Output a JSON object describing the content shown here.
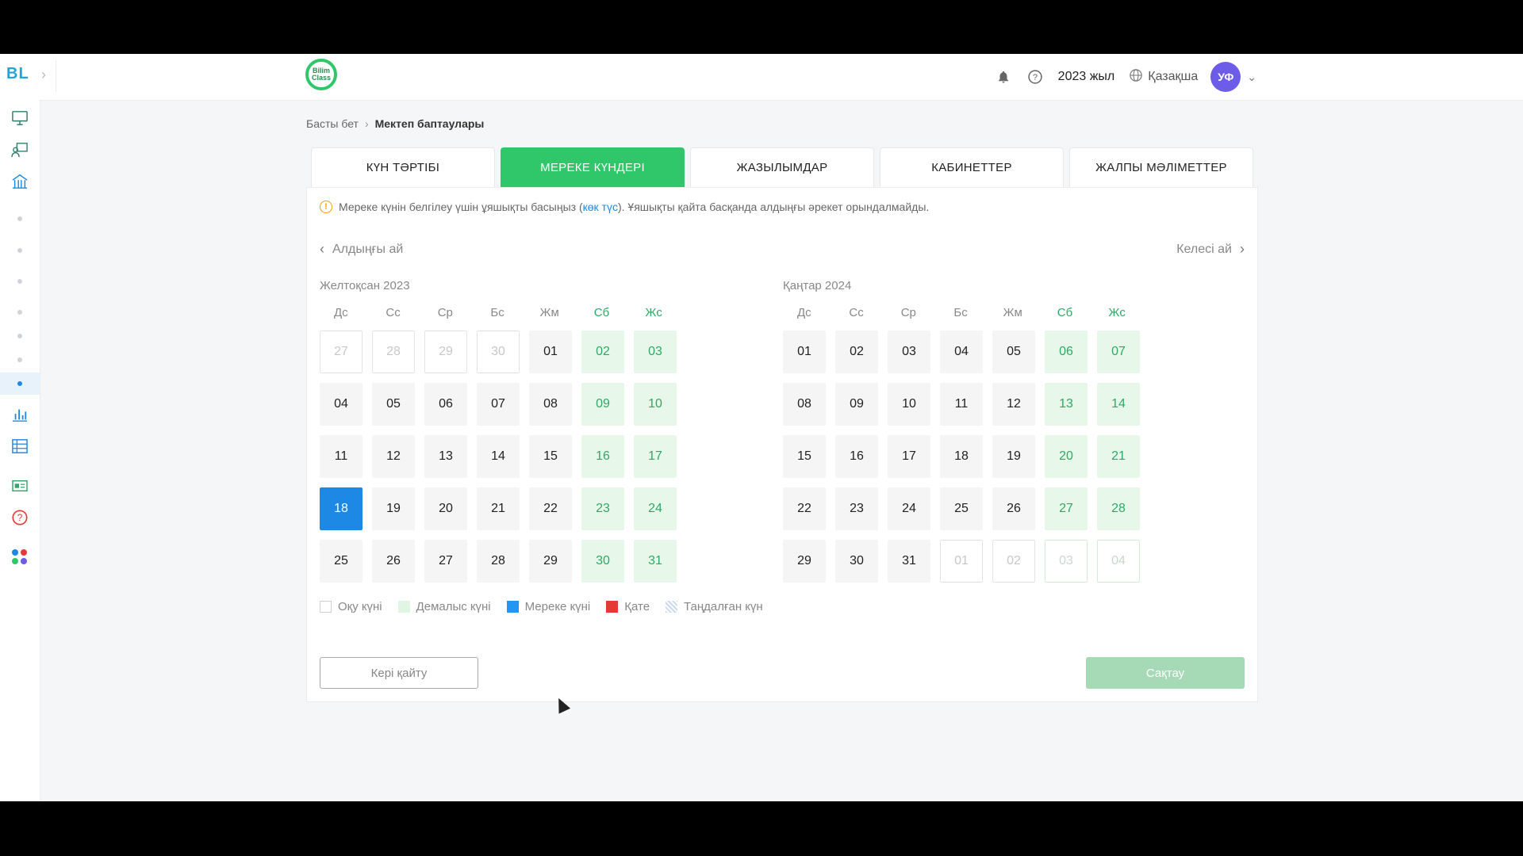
{
  "header": {
    "app_logo": "BL",
    "brand": "Bilim Class",
    "year": "2023 жыл",
    "language": "Қазақша",
    "avatar": "УФ"
  },
  "breadcrumb": {
    "home": "Басты бет",
    "current": "Мектеп баптаулары"
  },
  "tabs": [
    {
      "label": "КҮН ТӘРТІБІ"
    },
    {
      "label": "МЕРЕКЕ КҮНДЕРІ"
    },
    {
      "label": "ЖАЗЫЛЫМДАР"
    },
    {
      "label": "КАБИНЕТТЕР"
    },
    {
      "label": "ЖАЛПЫ МӘЛІМЕТТЕР"
    }
  ],
  "info": {
    "text_before": "Мереке күнін белгілеу үшін ұяшықты басыңыз (",
    "link": "көк түс",
    "text_after": "). Ұяшықты қайта басқанда алдыңғы әрекет орындалмайды."
  },
  "nav": {
    "prev": "Алдыңғы ай",
    "next": "Келесі ай"
  },
  "weekdays": [
    "Дс",
    "Сс",
    "Ср",
    "Бс",
    "Жм",
    "Сб",
    "Жс"
  ],
  "months": [
    {
      "title": "Желтоқсан 2023",
      "days": [
        {
          "d": "27",
          "t": "out"
        },
        {
          "d": "28",
          "t": "out"
        },
        {
          "d": "29",
          "t": "out"
        },
        {
          "d": "30",
          "t": "out"
        },
        {
          "d": "01",
          "t": "study"
        },
        {
          "d": "02",
          "t": "we"
        },
        {
          "d": "03",
          "t": "we"
        },
        {
          "d": "04",
          "t": "study"
        },
        {
          "d": "05",
          "t": "study"
        },
        {
          "d": "06",
          "t": "study"
        },
        {
          "d": "07",
          "t": "study"
        },
        {
          "d": "08",
          "t": "study"
        },
        {
          "d": "09",
          "t": "we"
        },
        {
          "d": "10",
          "t": "we"
        },
        {
          "d": "11",
          "t": "study"
        },
        {
          "d": "12",
          "t": "study"
        },
        {
          "d": "13",
          "t": "study"
        },
        {
          "d": "14",
          "t": "study"
        },
        {
          "d": "15",
          "t": "study"
        },
        {
          "d": "16",
          "t": "we"
        },
        {
          "d": "17",
          "t": "we"
        },
        {
          "d": "18",
          "t": "sel"
        },
        {
          "d": "19",
          "t": "study"
        },
        {
          "d": "20",
          "t": "study"
        },
        {
          "d": "21",
          "t": "study"
        },
        {
          "d": "22",
          "t": "study"
        },
        {
          "d": "23",
          "t": "we"
        },
        {
          "d": "24",
          "t": "we"
        },
        {
          "d": "25",
          "t": "study"
        },
        {
          "d": "26",
          "t": "study"
        },
        {
          "d": "27",
          "t": "study"
        },
        {
          "d": "28",
          "t": "study"
        },
        {
          "d": "29",
          "t": "study"
        },
        {
          "d": "30",
          "t": "we"
        },
        {
          "d": "31",
          "t": "we"
        }
      ]
    },
    {
      "title": "Қаңтар 2024",
      "days": [
        {
          "d": "01",
          "t": "study"
        },
        {
          "d": "02",
          "t": "study"
        },
        {
          "d": "03",
          "t": "study"
        },
        {
          "d": "04",
          "t": "study"
        },
        {
          "d": "05",
          "t": "study"
        },
        {
          "d": "06",
          "t": "we"
        },
        {
          "d": "07",
          "t": "we"
        },
        {
          "d": "08",
          "t": "study"
        },
        {
          "d": "09",
          "t": "study"
        },
        {
          "d": "10",
          "t": "study"
        },
        {
          "d": "11",
          "t": "study"
        },
        {
          "d": "12",
          "t": "study"
        },
        {
          "d": "13",
          "t": "we"
        },
        {
          "d": "14",
          "t": "we"
        },
        {
          "d": "15",
          "t": "study"
        },
        {
          "d": "16",
          "t": "study"
        },
        {
          "d": "17",
          "t": "study"
        },
        {
          "d": "18",
          "t": "study"
        },
        {
          "d": "19",
          "t": "study"
        },
        {
          "d": "20",
          "t": "we"
        },
        {
          "d": "21",
          "t": "we"
        },
        {
          "d": "22",
          "t": "study"
        },
        {
          "d": "23",
          "t": "study"
        },
        {
          "d": "24",
          "t": "study"
        },
        {
          "d": "25",
          "t": "study"
        },
        {
          "d": "26",
          "t": "study"
        },
        {
          "d": "27",
          "t": "we"
        },
        {
          "d": "28",
          "t": "we"
        },
        {
          "d": "29",
          "t": "study"
        },
        {
          "d": "30",
          "t": "study"
        },
        {
          "d": "31",
          "t": "study"
        },
        {
          "d": "01",
          "t": "out"
        },
        {
          "d": "02",
          "t": "out"
        },
        {
          "d": "03",
          "t": "out_we"
        },
        {
          "d": "04",
          "t": "out_we"
        }
      ]
    }
  ],
  "legend": {
    "study": "Оқу күні",
    "rest": "Демалыс күні",
    "holiday": "Мереке күні",
    "error": "Қате",
    "selected": "Таңдалған күн"
  },
  "buttons": {
    "back": "Кері қайту",
    "save": "Сақтау"
  },
  "colors": {
    "accent": "#2fc76a",
    "holiday": "#1e88e5",
    "error": "#e53935"
  }
}
